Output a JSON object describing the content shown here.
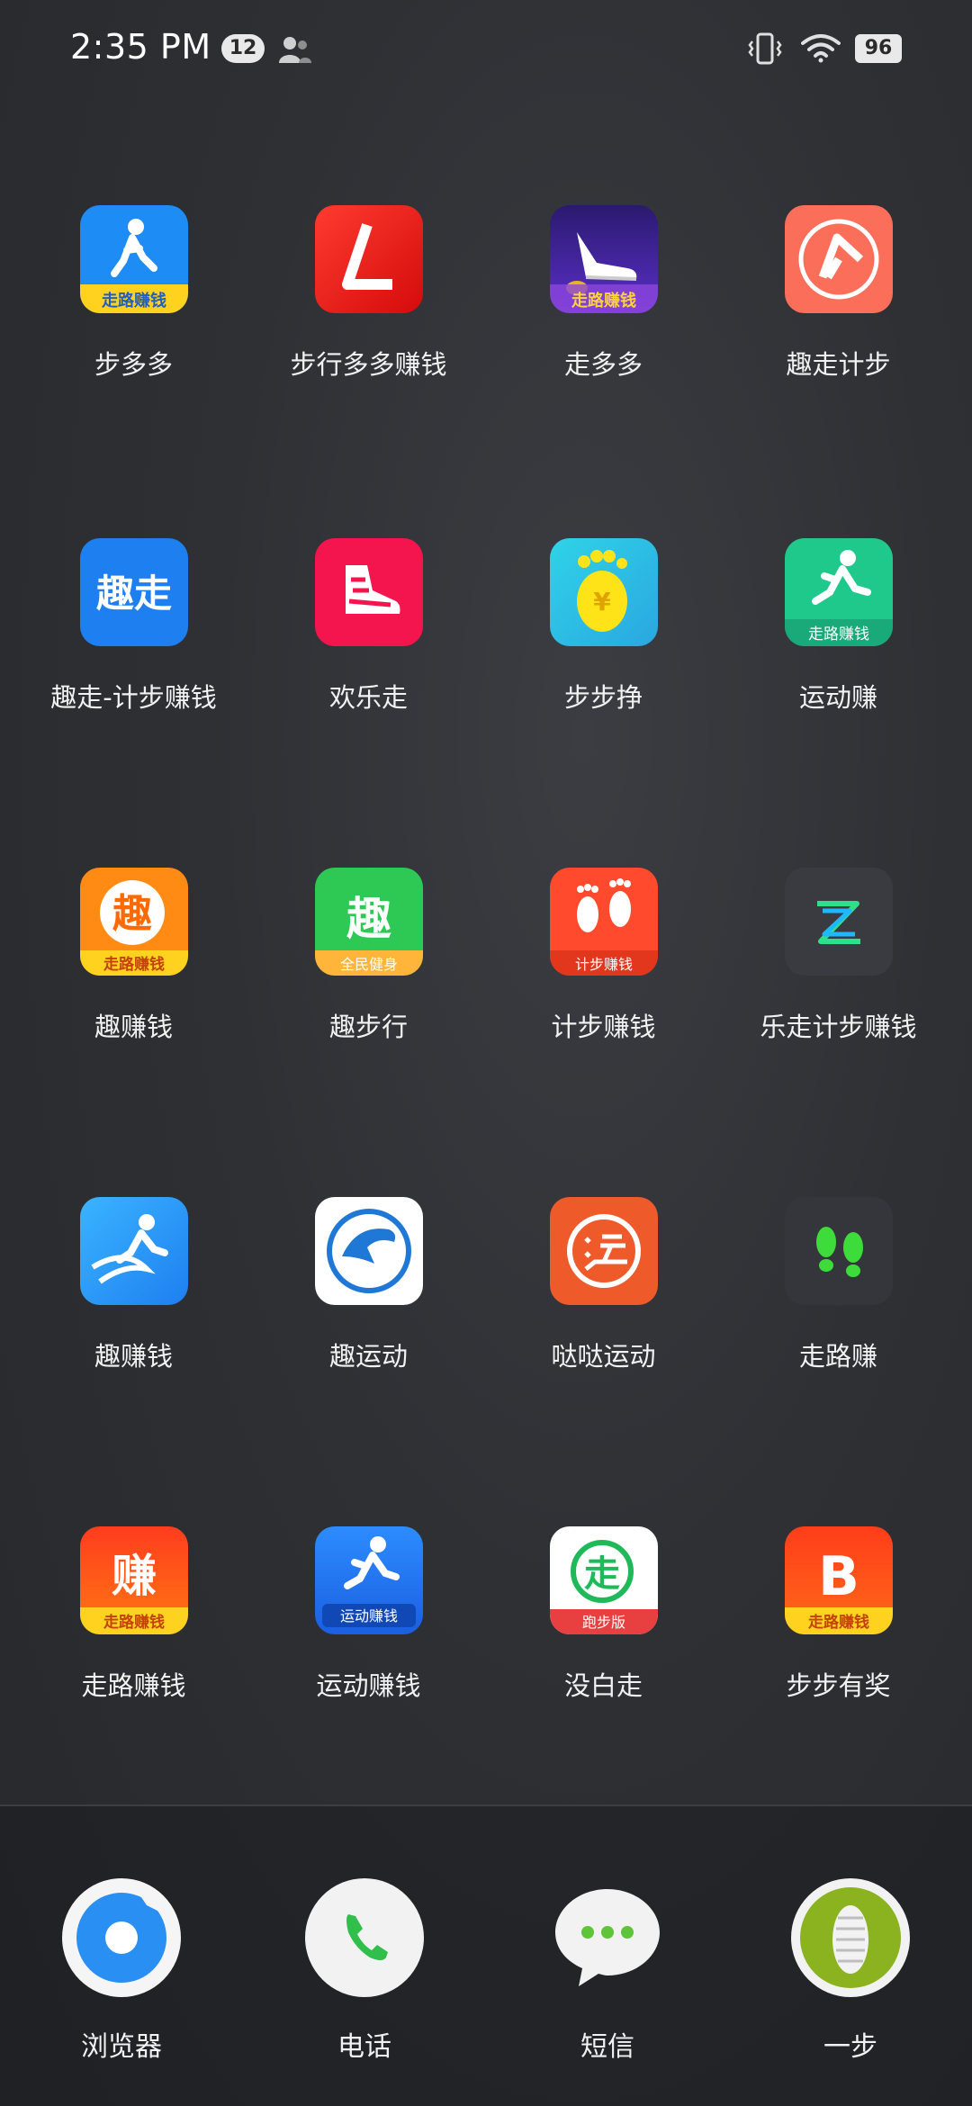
{
  "status_bar": {
    "time": "2:35 PM",
    "notification_count": "12",
    "battery": "96"
  },
  "apps": [
    {
      "label": "步多多",
      "icon": "walker-icon",
      "badge": "走路赚钱"
    },
    {
      "label": "步行多多赚钱",
      "icon": "l-logo-icon"
    },
    {
      "label": "走多多",
      "icon": "shoe-icon",
      "badge": "走路赚钱"
    },
    {
      "label": "趣走计步",
      "icon": "arrow-logo-icon"
    },
    {
      "label": "趣走-计步赚钱",
      "icon": "quzou-text-icon",
      "text": "趣走"
    },
    {
      "label": "欢乐走",
      "icon": "sneaker-icon"
    },
    {
      "label": "步步挣",
      "icon": "footprint-coin-icon"
    },
    {
      "label": "运动赚",
      "icon": "runner-icon",
      "badge": "走路赚钱"
    },
    {
      "label": "趣赚钱",
      "icon": "qu-char-icon",
      "text": "趣",
      "badge": "走路赚钱"
    },
    {
      "label": "趣步行",
      "icon": "qu-green-icon",
      "text": "趣",
      "badge": "全民健身"
    },
    {
      "label": "计步赚钱",
      "icon": "footprints-icon",
      "badge": "计步赚钱"
    },
    {
      "label": "乐走计步赚钱",
      "icon": "z-logo-icon"
    },
    {
      "label": "趣赚钱",
      "icon": "runner-swoosh-icon"
    },
    {
      "label": "趣运动",
      "icon": "dolphin-icon"
    },
    {
      "label": "哒哒运动",
      "icon": "yun-circle-icon"
    },
    {
      "label": "走路赚",
      "icon": "green-footprints-icon"
    },
    {
      "label": "走路赚钱",
      "icon": "zhuan-char-icon",
      "text": "赚",
      "badge": "走路赚钱"
    },
    {
      "label": "运动赚钱",
      "icon": "runner-blue-icon",
      "badge": "运动赚钱"
    },
    {
      "label": "没白走",
      "icon": "zou-circle-icon",
      "text": "走",
      "badge": "跑步版"
    },
    {
      "label": "步步有奖",
      "icon": "b-logo-icon",
      "text": "B",
      "badge": "走路赚钱"
    }
  ],
  "dock": [
    {
      "label": "浏览器",
      "icon": "browser-icon"
    },
    {
      "label": "电话",
      "icon": "phone-icon"
    },
    {
      "label": "短信",
      "icon": "message-icon"
    },
    {
      "label": "一步",
      "icon": "shoe-sole-icon"
    }
  ],
  "colors": {
    "background": "#2e3034",
    "text": "#f2f2f2"
  }
}
